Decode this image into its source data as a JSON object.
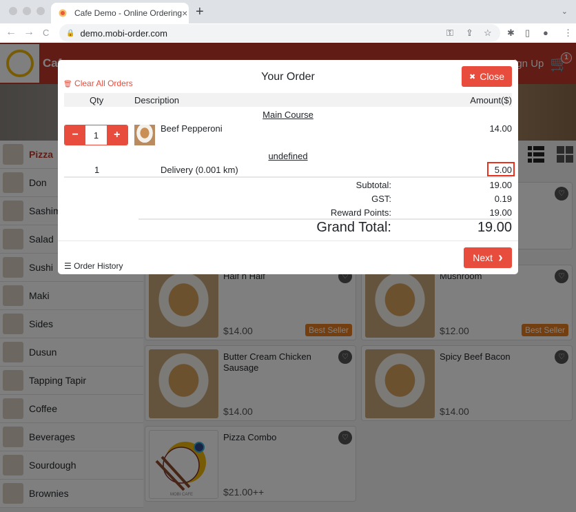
{
  "browser": {
    "tab_title": "Cafe Demo - Online Ordering",
    "tab_close": "×",
    "new_tab": "+",
    "tab_dropdown": "⌄",
    "url": "demo.mobi-order.com",
    "back": "←",
    "forward": "→",
    "reload": "C",
    "key_icon": "⚿",
    "share_icon": "⇪",
    "star_icon": "☆",
    "ext_icon": "✱",
    "panel_icon": "▯",
    "profile_icon": "●",
    "menu_icon": "⋮"
  },
  "header": {
    "brand": "Cafe",
    "signup": "Sign Up",
    "cart_icon": "🛒",
    "cart_count": "1",
    "accent": "#c0392b"
  },
  "sidebar": {
    "items": [
      {
        "label": "Pizza",
        "active": true
      },
      {
        "label": "Don"
      },
      {
        "label": "Sashimi"
      },
      {
        "label": "Salad"
      },
      {
        "label": "Sushi"
      },
      {
        "label": "Maki"
      },
      {
        "label": "Sides"
      },
      {
        "label": "Dusun"
      },
      {
        "label": "Tapping Tapir"
      },
      {
        "label": "Coffee"
      },
      {
        "label": "Beverages"
      },
      {
        "label": "Sourdough"
      },
      {
        "label": "Brownies"
      }
    ]
  },
  "products": [
    {
      "name": "Half n Half",
      "price": "$14.00",
      "badge": "Best Seller"
    },
    {
      "name": "Mushroom",
      "price": "$12.00",
      "badge": "Best Seller"
    },
    {
      "name": "Butter Cream Chicken Sausage",
      "price": "$14.00"
    },
    {
      "name": "Spicy Beef Bacon",
      "price": "$14.00"
    },
    {
      "name": "Pizza Combo",
      "price": "$21.00++"
    }
  ],
  "heart_icon": "♡",
  "modal": {
    "title": "Your Order",
    "clear_all": "Clear All Orders",
    "trash_icon": "🗑",
    "close_label": "Close",
    "close_icon": "✖",
    "columns": {
      "qty": "Qty",
      "description": "Description",
      "amount": "Amount($)"
    },
    "sections": [
      {
        "title": "Main Course",
        "items": [
          {
            "qty": "1",
            "description": "Beef Pepperoni",
            "amount": "14.00"
          }
        ]
      },
      {
        "title": "undefined",
        "items": [
          {
            "qty": "1",
            "description": "Delivery (0.001 km)",
            "amount": "5.00"
          }
        ]
      }
    ],
    "minus": "−",
    "plus": "+",
    "summary": {
      "subtotal_label": "Subtotal:",
      "subtotal": "19.00",
      "gst_label": "GST:",
      "gst": "0.19",
      "reward_label": "Reward Points:",
      "reward": "19.00",
      "grand_label": "Grand Total:",
      "grand": "19.00"
    },
    "next_label": "Next",
    "next_icon": "›",
    "history_icon": "☰",
    "history_label": "Order History"
  }
}
